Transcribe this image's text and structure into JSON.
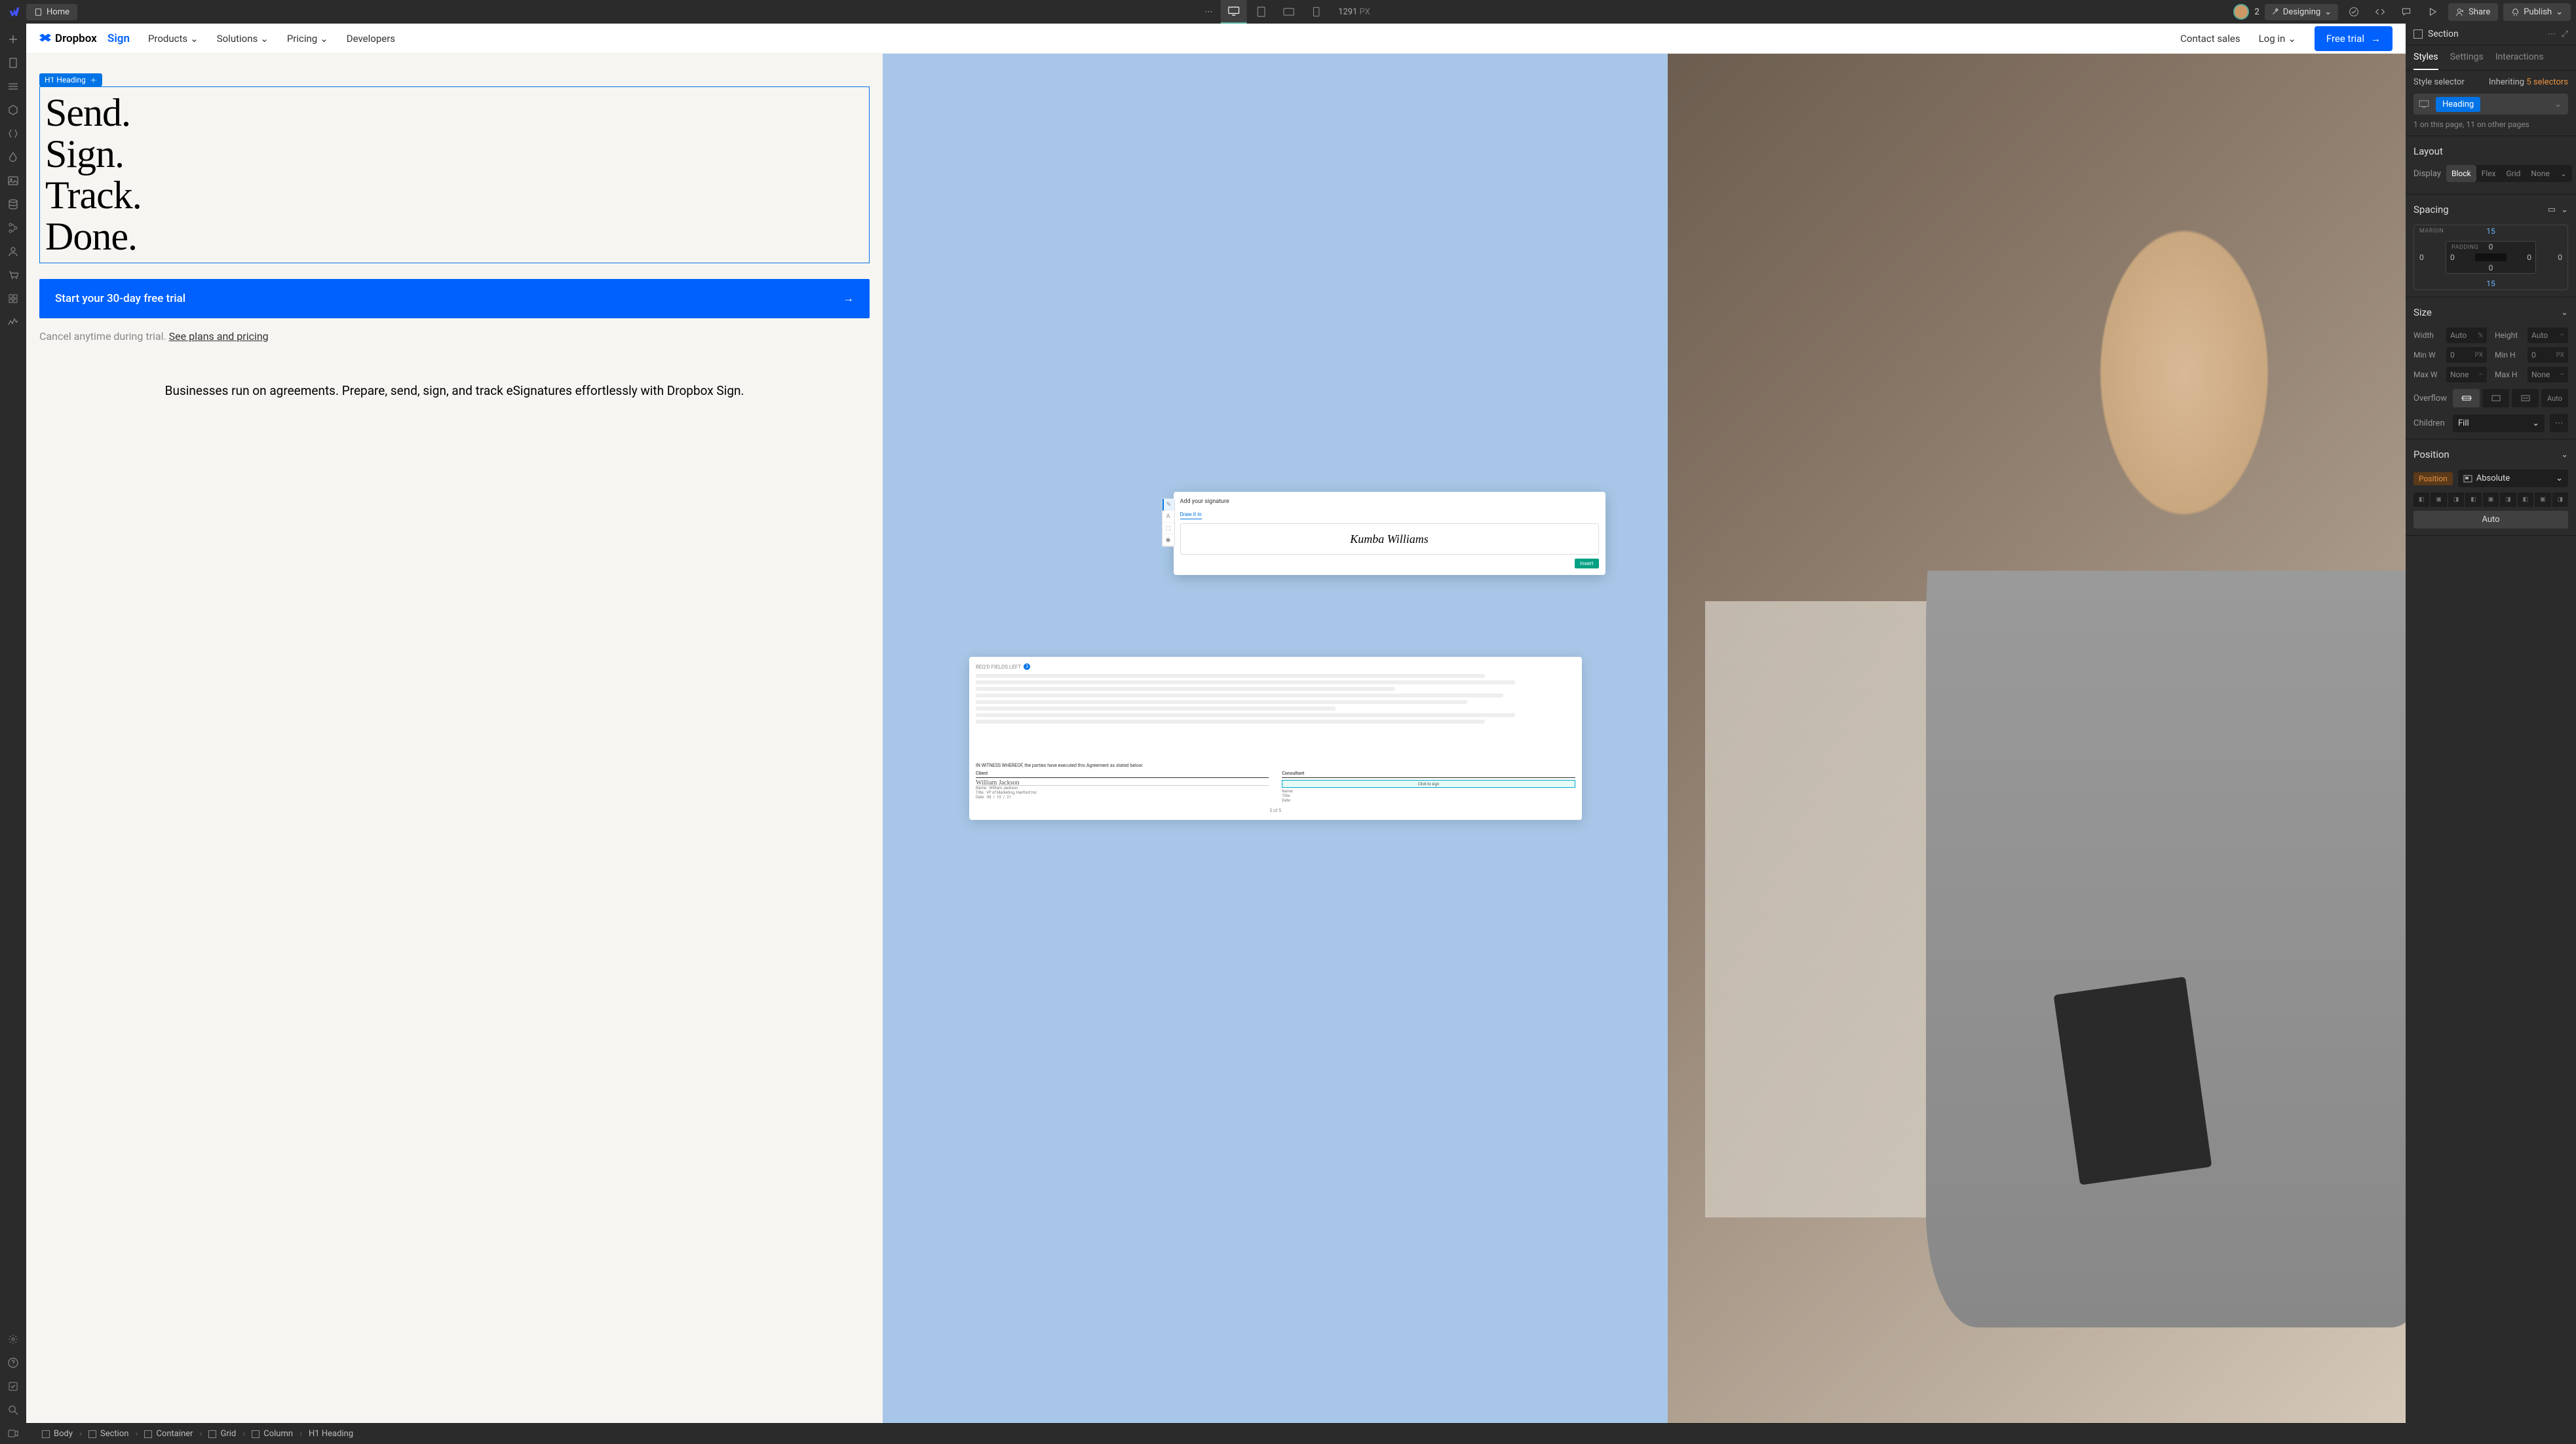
{
  "topbar": {
    "home": "Home",
    "canvas_width": "1291",
    "px_suffix": "PX",
    "user_count": "2",
    "mode": "Designing",
    "share": "Share",
    "publish": "Publish"
  },
  "site": {
    "logo_a": "Dropbox",
    "logo_b": "Sign",
    "nav": [
      "Products",
      "Solutions",
      "Pricing",
      "Developers"
    ],
    "contact": "Contact sales",
    "login": "Log in",
    "free_trial": "Free trial",
    "badge": "H1  Heading",
    "h1": "Send.\nSign.\nTrack.\nDone.",
    "trial_cta": "Start your 30-day free trial",
    "cancel": "Cancel anytime during trial.",
    "plans_link": "See plans and pricing",
    "business": "Businesses run on agreements. Prepare, send, sign, and track eSignatures effortlessly with Dropbox Sign.",
    "sig": {
      "fields_left": "REQ'D FIELDS LEFT",
      "fields_num": "3",
      "popup_title": "Add your signature",
      "draw_tab": "Draw it in",
      "signature_name": "Kumba Williams",
      "insert": "Insert",
      "witness": "IN WITNESS WHEREOF, the parties have executed this Agreement as stated below:",
      "client": "Client",
      "consultant": "Consultant",
      "click_sign": "Click to sign",
      "name_lbl": "Name:",
      "title_lbl": "Title:",
      "date_lbl": "Date:",
      "client_name": "William Jackson",
      "client_title": "VP of Marketing, Hanford Inc",
      "client_date_m": "08",
      "client_date_d": "10",
      "client_date_y": "21",
      "page": "5 of 5"
    }
  },
  "breadcrumb": [
    "Body",
    "Section",
    "Container",
    "Grid",
    "Column",
    "H1   Heading"
  ],
  "panel": {
    "element": "Section",
    "tabs": [
      "Styles",
      "Settings",
      "Interactions"
    ],
    "selector_label": "Style selector",
    "inheriting": "Inheriting",
    "inherit_count": "5 selectors",
    "selector_tag": "Heading",
    "selector_count": "1 on this page, 11 on other pages",
    "layout_h": "Layout",
    "display_label": "Display",
    "display_opts": [
      "Block",
      "Flex",
      "Grid",
      "None"
    ],
    "spacing_h": "Spacing",
    "margin_label": "MARGIN",
    "padding_label": "PADDING",
    "margin": {
      "top": "15",
      "right": "0",
      "bottom": "15",
      "left": "0"
    },
    "padding": {
      "top": "0",
      "right": "0",
      "bottom": "0",
      "left": "0"
    },
    "size_h": "Size",
    "width_l": "Width",
    "width_v": "Auto",
    "width_u": "%",
    "height_l": "Height",
    "height_v": "Auto",
    "height_u": "–",
    "minw_l": "Min W",
    "minw_v": "0",
    "minw_u": "PX",
    "minh_l": "Min H",
    "minh_v": "0",
    "minh_u": "PX",
    "maxw_l": "Max W",
    "maxw_v": "None",
    "maxw_u": "–",
    "maxh_l": "Max H",
    "maxh_v": "None",
    "maxh_u": "–",
    "overflow_l": "Overflow",
    "overflow_auto": "Auto",
    "children_l": "Children",
    "children_v": "Fill",
    "position_h": "Position",
    "position_l": "Position",
    "position_v": "Absolute",
    "pos_auto": "Auto"
  }
}
